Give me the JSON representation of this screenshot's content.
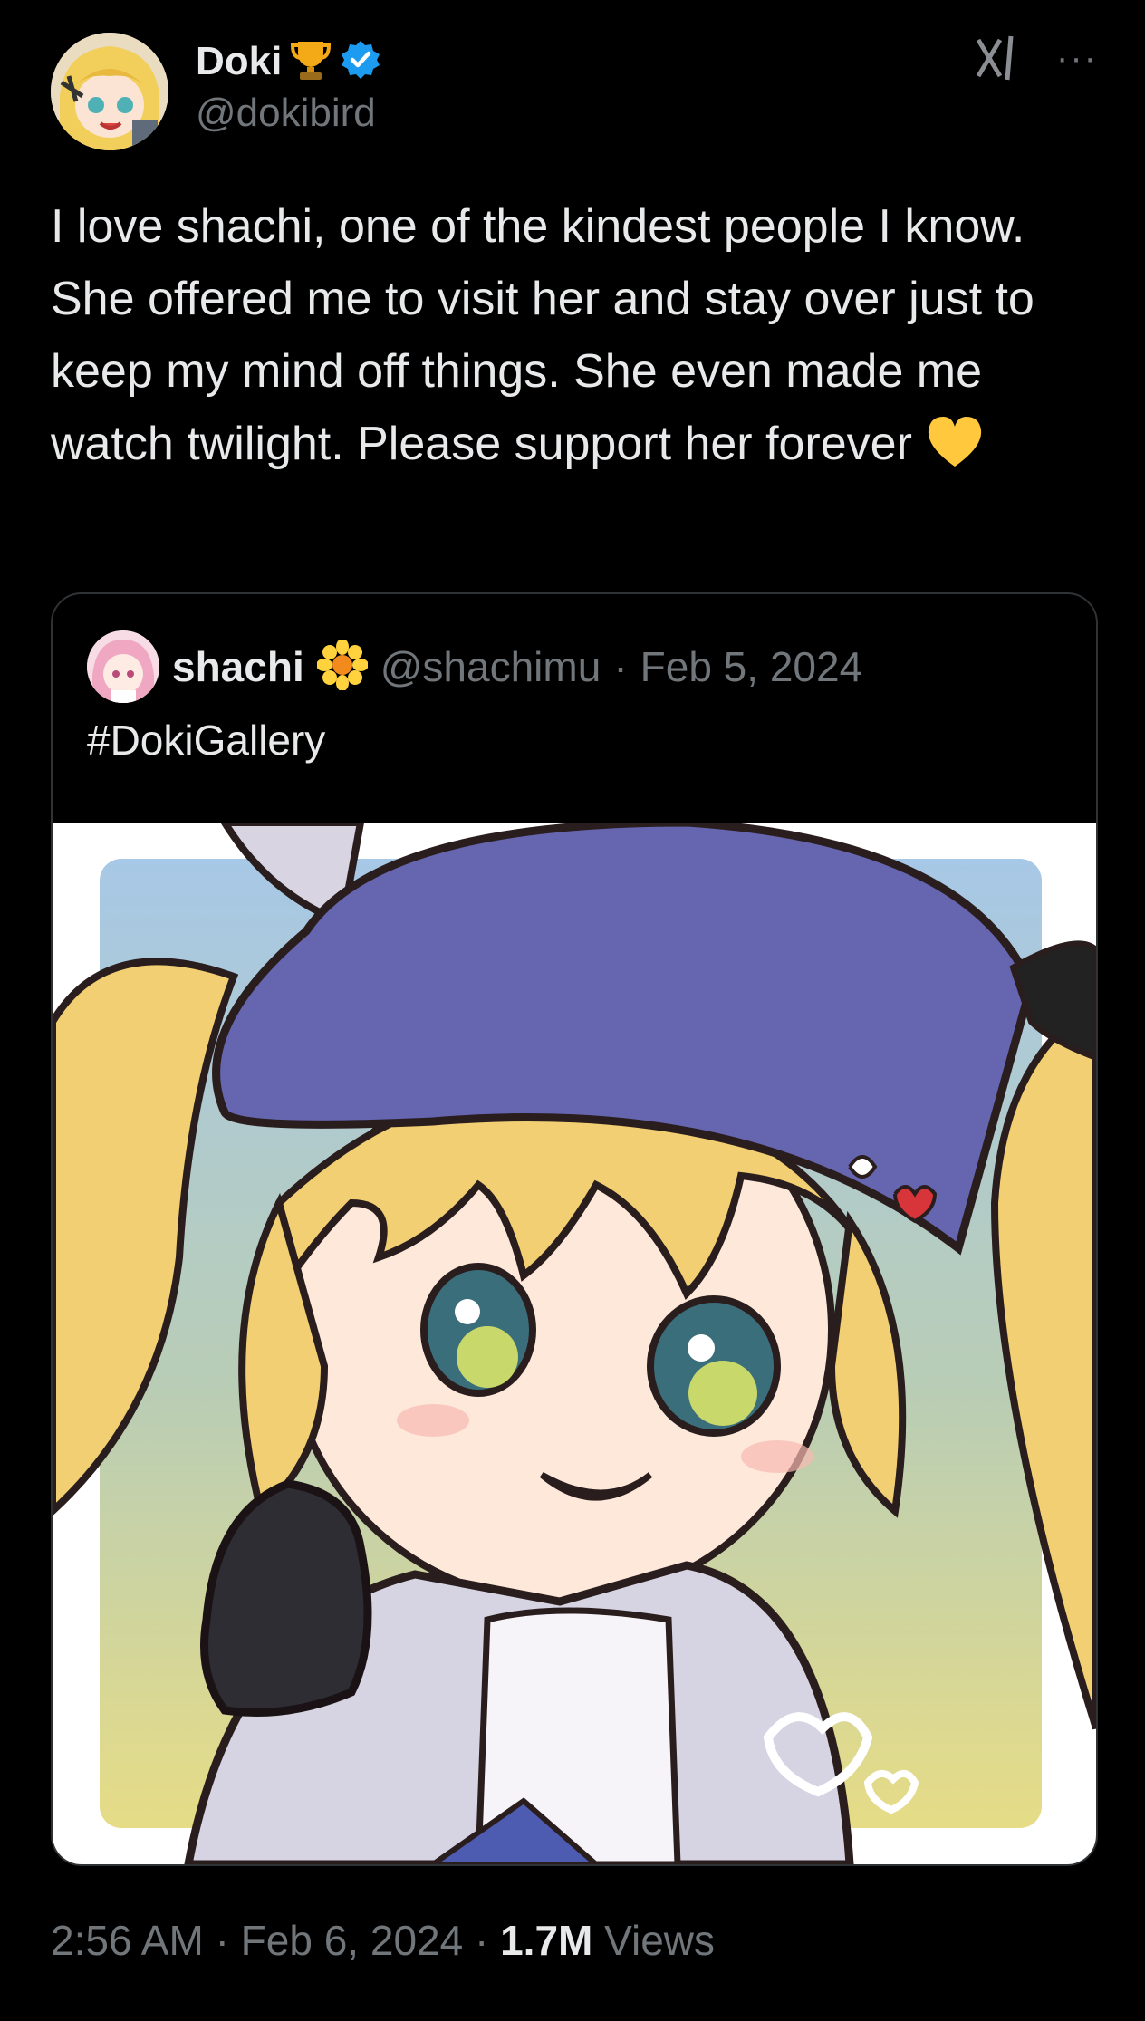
{
  "author": {
    "display_name": "Doki",
    "handle": "@dokibird",
    "badges": [
      "trophy-icon",
      "verified-badge-icon"
    ]
  },
  "actions": {
    "grok_icon": "grok-icon",
    "more": "···"
  },
  "tweet": {
    "text": "I love shachi, one of the kindest people I know. She offered me to visit her and stay over just to keep my mind off things. She even made me watch twilight. Please support her forever",
    "emoji": "yellow-heart-icon"
  },
  "quoted": {
    "display_name": "shachi",
    "badge": "sunflower-icon",
    "handle": "@shachimu",
    "separator": "·",
    "date": "Feb 5, 2024",
    "text": "#DokiGallery",
    "image_alt": "chibi-illustration"
  },
  "footer": {
    "time": "2:56 AM",
    "sep1": "·",
    "date": "Feb 6, 2024",
    "sep2": "·",
    "views_count": "1.7M",
    "views_label": "Views"
  },
  "colors": {
    "background": "#000000",
    "text": "#e7e9ea",
    "muted": "#71767b",
    "verified": "#1d9bf0",
    "border": "#2f3336"
  }
}
